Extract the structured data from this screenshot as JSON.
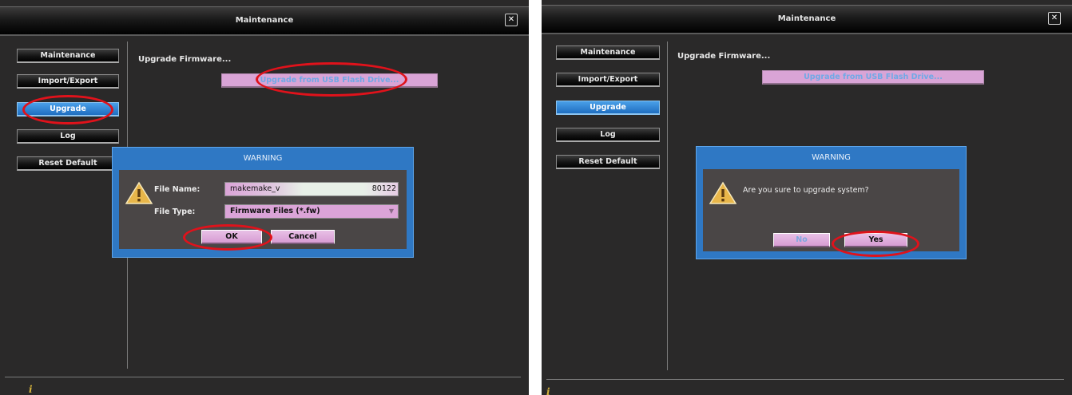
{
  "panels": [
    {
      "window_title": "Maintenance",
      "close_glyph": "✕",
      "nav": [
        "Maintenance",
        "Import/Export",
        "Upgrade",
        "Log",
        "Reset Default"
      ],
      "active_nav": "Upgrade",
      "section_title": "Upgrade Firmware...",
      "usb_button": "Upgrade from USB Flash Drive...",
      "dialog": {
        "title": "WARNING",
        "file_name_label": "File Name:",
        "file_name_value_left": "makemake_v",
        "file_name_value_right": "80122",
        "file_type_label": "File Type:",
        "file_type_value": "Firmware Files (*.fw)",
        "dropdown_glyph": "▼",
        "ok": "OK",
        "cancel": "Cancel"
      },
      "info_glyph": "i"
    },
    {
      "window_title": "Maintenance",
      "close_glyph": "✕",
      "nav": [
        "Maintenance",
        "Import/Export",
        "Upgrade",
        "Log",
        "Reset Default"
      ],
      "active_nav": "Upgrade",
      "section_title": "Upgrade Firmware...",
      "usb_button": "Upgrade from USB Flash Drive...",
      "dialog": {
        "title": "WARNING",
        "message": "Are you sure to upgrade system?",
        "no": "No",
        "yes": "Yes"
      },
      "info_glyph": "i"
    }
  ],
  "colors": {
    "panel_bg": "#2a2929",
    "dialog_blue": "#2f78c4",
    "button_pink": "#d9a4d6",
    "annotation_red": "#e0121b",
    "active_blue": "#2a80d4"
  }
}
